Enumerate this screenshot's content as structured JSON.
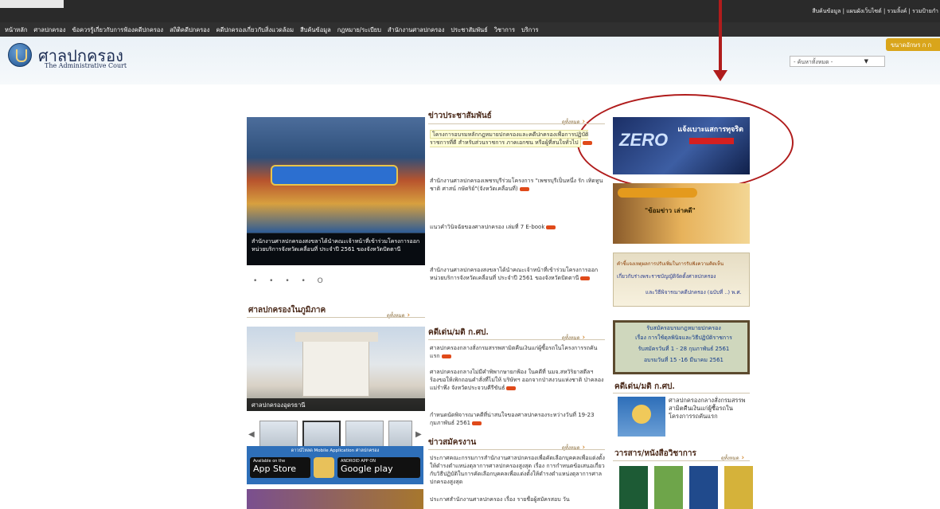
{
  "top_links": "สืบค้นข้อมูล | แผนผังเว็บไซต์ | รวมลิ้งค์ | รวมป้ายกำ",
  "nav": [
    "หน้าหลัก",
    "ศาลปกครอง",
    "ข้อควรรู้เกี่ยวกับการฟ้องคดีปกครอง",
    "สถิติคดีปกครอง",
    "คดีปกครองเกี่ยวกับสิ่งแวดล้อม",
    "สืบค้นข้อมูล",
    "กฎหมาย/ระเบียบ",
    "สำนักงานศาลปกครอง",
    "ประชาสัมพันธ์",
    "วิชาการ",
    "บริการ"
  ],
  "header": {
    "title_th": "ศาลปกครอง",
    "title_en": "The Administrative Court",
    "font_size_label": "ขนาดอักษร ก ก",
    "province_select": "- ค้นหาทั้งหมด -"
  },
  "slider": {
    "caption": "สำนักงานศาลปกครองสงขลาได้นำคณะเจ้าหน้าที่เข้าร่วมโครงการออกหน่วยบริการจังหวัดเคลื่อนที่ ประจำปี 2561 ของจังหวัดปัตตานี",
    "dots": "• • • • O"
  },
  "pr": {
    "title": "ข่าวประชาสัมพันธ์",
    "more": "ดูทั้งหมด",
    "items": [
      "โครงการอบรมหลักกฎหมายปกครองและคดีปกครองเพื่อการปฏิบัติราชการที่ดี สำหรับส่วนราชการ ภาคเอกชน หรือผู้ที่สนใจทั่วไป",
      "สำนักงานศาลปกครองเพชรบุรีร่วมโครงการ \"เพชรบุรีเป็นหนึ่ง รัก เทิดทูน ชาติ ศาสน์ กษัตริย์\"(จังหวัดเคลื่อนที่)",
      "แนวคำวินิจฉัยของศาลปกครอง เล่มที่ 7 E-book",
      "สำนักงานศาลปกครองสงขลาได้นำคณะเจ้าหน้าที่เข้าร่วมโครงการออกหน่วยบริการจังหวัดเคลื่อนที่ ประจำปี 2561 ของจังหวัดปัตตานี"
    ]
  },
  "regional": {
    "title": "ศาลปกครองในภูมิภาค",
    "more": "ดูทั้งหมด",
    "caption": "ศาลปกครองอุดรธานี"
  },
  "cases": {
    "title": "คดีเด่น/มติ ก.ศป.",
    "more": "ดูทั้งหมด",
    "items": [
      "ศาลปกครองกลางสั่งกรมสรรพสามิตคืนเงินแก่ผู้ซื้อรถในโครงการรถคันแรก",
      "ศาลปกครองกลางไม่มีคำพิพากษายกฟ้อง ในคดีที่ นมจ.สหวิริยาสตีลฯ ร้องขอให้เพิกถอนคำสั่งที่ไม่ให้ บริษัทฯ ออกจากป่าสงวนแห่งชาติ ป่าคลองแม่รำพึง จังหวัดประจวบคีรีขันธ์",
      "กำหนดนัดพิจารณาคดีที่น่าสนใจของศาลปกครองระหว่างวันที่ 19-23 กุมภาพันธ์ 2561"
    ]
  },
  "jobs": {
    "title": "ข่าวสมัครงาน",
    "more": "ดูทั้งหมด",
    "items": [
      "ประกาศคณะกรรมการสำนักงานศาลปกครองเพื่อคัดเลือกบุคคลเพื่อแต่งตั้งให้ดำรงตำแหน่งตุลาการศาลปกครองสูงสุด เรื่อง การกำหนดข้อเสนอเกี่ยวกับวิธีปฏิบัติในการคัดเลือกบุคคลเพื่อแต่งตั้งให้ดำรงตำแหน่งตุลาการศาลปกครองสูงสุด",
      "ประกาศสำนักงานศาลปกครอง เรื่อง รายชื่อผู้สมัครสอบ วัน"
    ]
  },
  "app": {
    "title": "ดาวน์โหลด Mobile Application ศาลปกครอง",
    "ios_small": "Available on the",
    "ios_big": "App Store",
    "android_small": "ANDROID APP ON",
    "android_big": "Google play"
  },
  "banners": {
    "zero_title": "แจ้งเบาะแสการทุจริต",
    "zero_logo": "ZERO",
    "news_text": "\"ข้อมข่าว เล่าคดี\"",
    "bill_l1": "คำชี้แจงเหตุผลการปรับเพิ่มในการรับฟังความคิดเห็น",
    "bill_l2": "เกี่ยวกับร่างพระราชบัญญัติจัดตั้งศาลปกครอง",
    "bill_l3": "และวิธีพิจารณาคดีปกครอง (ฉบับที่ ..) พ.ศ.",
    "train_l1": "รับสมัครอบรมกฎหมายปกครอง",
    "train_l2": "เรื่อง การใช้ดุลพินิจและวิธีปฏิบัติราชการ",
    "train_l3": "รับสมัครวันที่ 1 - 28 กุมภาพันธ์ 2561",
    "train_l4": "อบรมวันที่ 15 -16 มีนาคม 2561"
  },
  "right_cases": {
    "title": "คดีเด่น/มติ ก.ศป.",
    "text": "ศาลปกครองกลางสั่งกรมสรรพสามิตคืนเงินแก่ผู้ซื้อรถในโครงการรถคันแรก"
  },
  "docs": {
    "title": "วารสาร/หนังสือวิชาการ",
    "more": "ดูทั้งหมด"
  }
}
